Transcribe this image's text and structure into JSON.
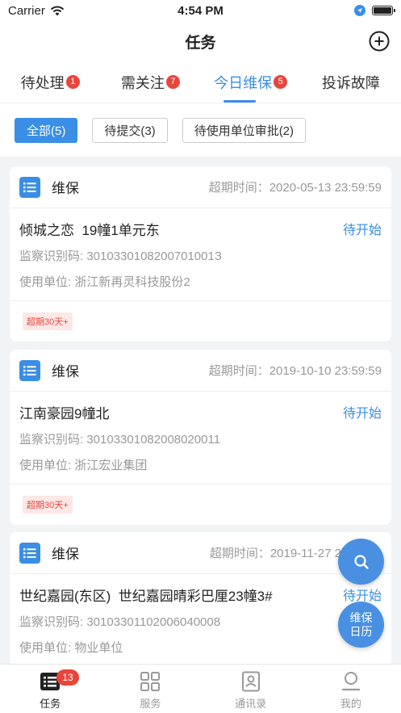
{
  "status_bar": {
    "carrier": "Carrier",
    "time": "4:54 PM"
  },
  "nav": {
    "title": "任务"
  },
  "tabs": [
    {
      "label": "待处理",
      "badge": "1"
    },
    {
      "label": "需关注",
      "badge": "7"
    },
    {
      "label": "今日维保",
      "badge": "5"
    },
    {
      "label": "投诉故障",
      "badge": ""
    }
  ],
  "filters": [
    {
      "label": "全部(5)"
    },
    {
      "label": "待提交(3)"
    },
    {
      "label": "待使用单位审批(2)"
    }
  ],
  "cards": [
    {
      "type": "维保",
      "deadline": "超期时间：2020-05-13 23:59:59",
      "address": "倾城之恋  19幢1单元东",
      "status": "待开始",
      "code": "监察识别码: 3010330108200701001З",
      "unit": "使用单位: 浙江新再灵科技股份2",
      "tag": "超期30天+"
    },
    {
      "type": "维保",
      "deadline": "超期时间：2019-10-10 23:59:59",
      "address": "江南豪园9幢北",
      "status": "待开始",
      "code": "监察识别码: 30103301082008020011",
      "unit": "使用单位: 浙江宏业集团",
      "tag": "超期30天+"
    },
    {
      "type": "维保",
      "deadline": "超期时间：2019-11-27 23:59:59",
      "address": "世纪嘉园(东区)  世纪嘉园晴彩巴厘23幢3#",
      "status": "待开始",
      "code": "监察识别码: 30103301102006040008",
      "unit": "使用单位: 物业单位",
      "tag": ""
    }
  ],
  "fab": {
    "calendar_line1": "维保",
    "calendar_line2": "日历"
  },
  "tabbar": [
    {
      "label": "任务",
      "badge": "13",
      "icon": "task-list-icon"
    },
    {
      "label": "服务",
      "icon": "grid-icon"
    },
    {
      "label": "通讯录",
      "icon": "contacts-icon"
    },
    {
      "label": "我的",
      "icon": "person-icon"
    }
  ],
  "colors": {
    "accent": "#3a8ee6",
    "badge": "#e8453c",
    "overdue_bg": "#fde8e6"
  }
}
